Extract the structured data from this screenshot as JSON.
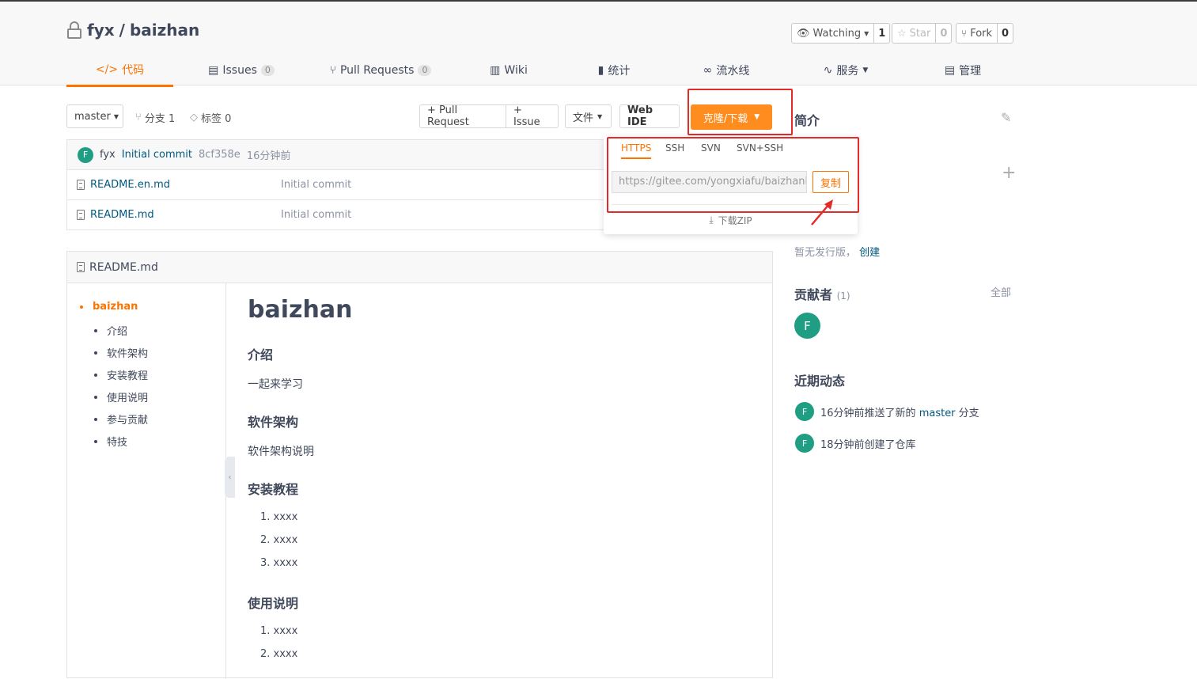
{
  "repo": {
    "owner": "fyx",
    "separator": "/",
    "name": "baizhan"
  },
  "repo_actions": {
    "watch": {
      "label": "Watching",
      "count": "1"
    },
    "star": {
      "label": "Star",
      "count": "0"
    },
    "fork": {
      "label": "Fork",
      "count": "0"
    }
  },
  "nav": {
    "code": "代码",
    "issues": "Issues",
    "issues_count": "0",
    "pulls": "Pull Requests",
    "pulls_count": "0",
    "wiki": "Wiki",
    "stats": "统计",
    "pipeline": "流水线",
    "services": "服务",
    "manage": "管理"
  },
  "toolbar": {
    "branch": "master",
    "branches": "分支 1",
    "tags": "标签 0",
    "pull_request": "+ Pull Request",
    "issue": "+ Issue",
    "file": "文件",
    "web_ide": "Web IDE",
    "clone": "克隆/下载"
  },
  "commit": {
    "author": "fyx",
    "avatar": "F",
    "message": "Initial commit",
    "hash": "8cf358e",
    "time": "16分钟前"
  },
  "files": [
    {
      "name": "README.en.md",
      "message": "Initial commit"
    },
    {
      "name": "README.md",
      "message": "Initial commit"
    }
  ],
  "clone_dropdown": {
    "tabs": [
      "HTTPS",
      "SSH",
      "SVN",
      "SVN+SSH"
    ],
    "active_tab": "HTTPS",
    "url": "https://gitee.com/yongxiafu/baizhanb.",
    "copy": "复制",
    "zip": "下载ZIP"
  },
  "readme": {
    "filename": "README.md",
    "toc": [
      "baizhan",
      "介绍",
      "软件架构",
      "安装教程",
      "使用说明",
      "参与贡献",
      "特技"
    ],
    "title": "baizhan",
    "sections": [
      {
        "heading": "介绍",
        "text": "一起来学习"
      },
      {
        "heading": "软件架构",
        "text": "软件架构说明"
      },
      {
        "heading": "安装教程",
        "items": [
          "1. xxxx",
          "2. xxxx",
          "3. xxxx"
        ]
      },
      {
        "heading": "使用说明",
        "items": [
          "1. xxxx",
          "2. xxxx"
        ]
      }
    ]
  },
  "sidebar": {
    "intro": "简介",
    "release_text": "暂无发行版，",
    "release_link": "创建",
    "contributors": "贡献者",
    "contributors_count": "(1)",
    "all": "全部",
    "contributor_avatar": "F",
    "activity_title": "近期动态",
    "activities": [
      {
        "avatar": "F",
        "before": "16分钟前推送了新的",
        "branch": "master",
        "after": "分支"
      },
      {
        "avatar": "F",
        "text": "18分钟前创建了仓库"
      }
    ]
  },
  "colors": {
    "accent": "#fe7300",
    "clone_button": "#fe8c1e",
    "highlight_box": "#e52a2a",
    "avatar": "#1f9e84",
    "link": "#005980"
  }
}
